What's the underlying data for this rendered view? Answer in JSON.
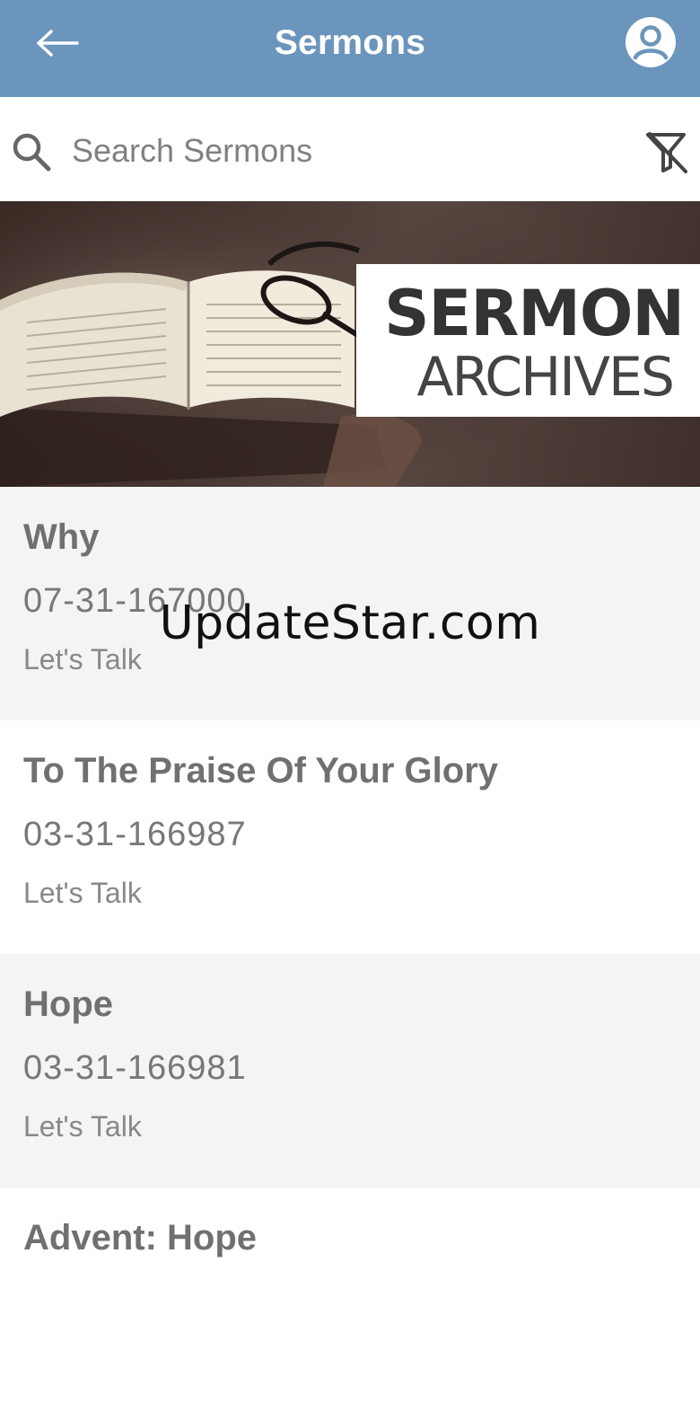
{
  "header": {
    "title": "Sermons",
    "back_icon": "arrow-left-icon",
    "account_icon": "account-circle-icon",
    "background_color": "#6b95bc"
  },
  "search": {
    "placeholder": "Search Sermons",
    "value": "",
    "search_icon": "magnifier-icon",
    "filter_icon": "filter-off-icon"
  },
  "banner": {
    "line1": "SERMON",
    "line2": "ARCHIVES"
  },
  "sermons": [
    {
      "title": "Why",
      "code": "07-31-167000",
      "speaker": "Let's Talk"
    },
    {
      "title": "To The Praise Of Your Glory",
      "code": "03-31-166987",
      "speaker": "Let's Talk"
    },
    {
      "title": "Hope",
      "code": "03-31-166981",
      "speaker": "Let's Talk"
    },
    {
      "title": "Advent: Hope",
      "code": "",
      "speaker": ""
    }
  ],
  "watermark": "UpdateStar.com"
}
